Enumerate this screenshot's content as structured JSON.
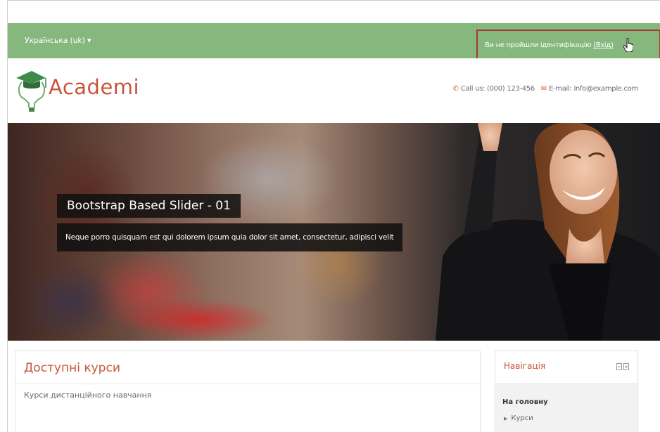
{
  "topbar": {
    "language": "Українська (uk) ▾",
    "login_status": "Ви не пройшли ідентифікацію",
    "login_link": "(Вхід)"
  },
  "header": {
    "logo_text": "Academi",
    "phone": "Call us: (000) 123-456",
    "email": "E-mail: info@example.com"
  },
  "slider": {
    "title": "Bootstrap Based Slider - 01",
    "text": "Neque porro quisquam est qui dolorem ipsum quia dolor sit amet, consectetur, adipisci velit"
  },
  "courses": {
    "title": "Доступні курси",
    "item": "Курси дистанційного навчання"
  },
  "navigation": {
    "title": "Навігація",
    "home": "На головну",
    "item": "Курси"
  },
  "colors": {
    "topbar": "#86b77d",
    "accent": "#c8553a",
    "highlight_border": "#a63a30"
  },
  "icons": [
    "graduation-cap-logo-icon",
    "phone-icon",
    "envelope-icon",
    "hand-cursor-icon",
    "block-control-icon",
    "triangle-right-icon"
  ]
}
